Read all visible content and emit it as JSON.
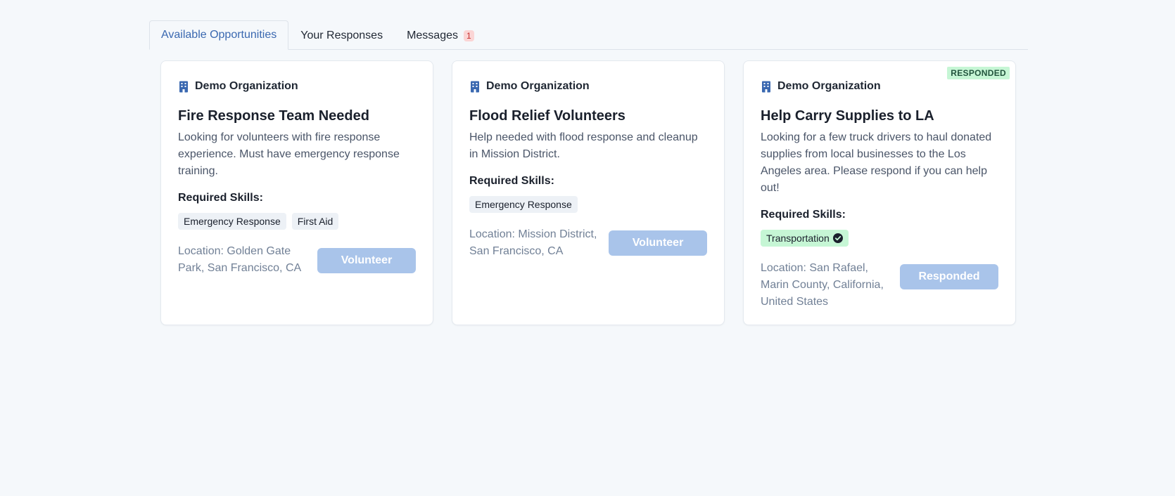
{
  "tabs": [
    {
      "label": "Available Opportunities"
    },
    {
      "label": "Your Responses"
    },
    {
      "label": "Messages",
      "badge": "1"
    }
  ],
  "cards": [
    {
      "organization": "Demo Organization",
      "title": "Fire Response Team Needed",
      "description": "Looking for volunteers with fire response experience. Must have emergency response training.",
      "skills_label": "Required Skills:",
      "skills": [
        "Emergency Response",
        "First Aid"
      ],
      "location": "Location: Golden Gate Park, San Francisco, CA",
      "button_label": "Volunteer"
    },
    {
      "organization": "Demo Organization",
      "title": "Flood Relief Volunteers",
      "description": "Help needed with flood response and cleanup in Mission District.",
      "skills_label": "Required Skills:",
      "skills": [
        "Emergency Response"
      ],
      "location": "Location: Mission District, San Francisco, CA",
      "button_label": "Volunteer"
    },
    {
      "organization": "Demo Organization",
      "title": "Help Carry Supplies to LA",
      "description": "Looking for a few truck drivers to haul donated supplies from local businesses to the Los Angeles area. Please respond if you can help out!",
      "skills_label": "Required Skills:",
      "skills": [
        "Transportation"
      ],
      "location": "Location: San Rafael, Marin County, California, United States",
      "button_label": "Responded",
      "status_badge": "RESPONDED"
    }
  ],
  "colors": {
    "accent": "#3a68b0",
    "button_disabled": "#a9c4ea",
    "responded_bg": "#c6f6d5",
    "responded_text": "#22543d",
    "message_badge_bg": "#fbd5d5"
  },
  "icons": {
    "organization": "building-icon",
    "skill_match": "check-circle-icon"
  }
}
